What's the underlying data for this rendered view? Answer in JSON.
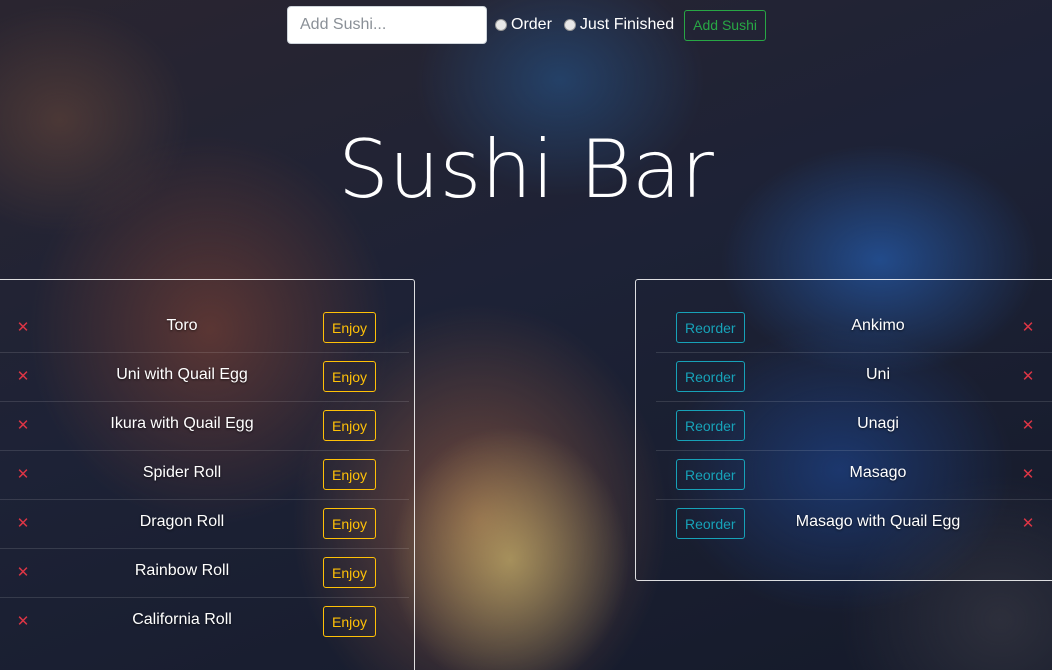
{
  "form": {
    "input_placeholder": "Add Sushi...",
    "input_value": "",
    "radio_order_label": "Order",
    "radio_finished_label": "Just Finished",
    "add_button_label": "Add Sushi"
  },
  "title": "Sushi Bar",
  "colors": {
    "enjoy_button": "#ffc107",
    "reorder_button": "#17a2b8",
    "add_button": "#28a745",
    "delete_icon": "#dc3545"
  },
  "order_list": {
    "enjoy_label": "Enjoy",
    "items": [
      {
        "name": "Toro"
      },
      {
        "name": "Uni with Quail Egg"
      },
      {
        "name": "Ikura with Quail Egg"
      },
      {
        "name": "Spider Roll"
      },
      {
        "name": "Dragon Roll"
      },
      {
        "name": "Rainbow Roll"
      },
      {
        "name": "California Roll"
      }
    ]
  },
  "finished_list": {
    "reorder_label": "Reorder",
    "items": [
      {
        "name": "Ankimo"
      },
      {
        "name": "Uni"
      },
      {
        "name": "Unagi"
      },
      {
        "name": "Masago"
      },
      {
        "name": "Masago with Quail Egg"
      }
    ]
  }
}
